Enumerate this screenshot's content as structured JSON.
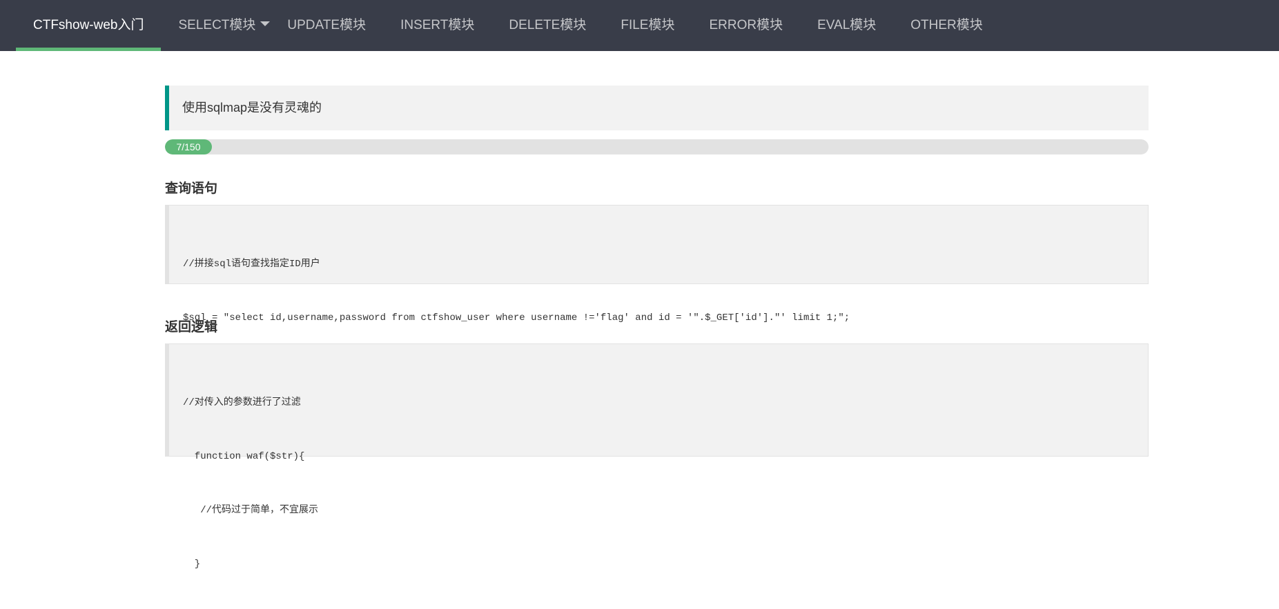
{
  "nav": {
    "items": [
      {
        "label": "CTFshow-web入门",
        "active": true
      },
      {
        "label": "SELECT模块",
        "dropdown": true
      },
      {
        "label": "UPDATE模块"
      },
      {
        "label": "INSERT模块"
      },
      {
        "label": "DELETE模块"
      },
      {
        "label": "FILE模块"
      },
      {
        "label": "ERROR模块"
      },
      {
        "label": "EVAL模块"
      },
      {
        "label": "OTHER模块"
      }
    ]
  },
  "quote": {
    "text": "使用sqlmap是没有灵魂的"
  },
  "progress": {
    "label": "7/150",
    "current": 7,
    "total": 150
  },
  "query": {
    "title": "查询语句",
    "lines": [
      "//拼接sql语句查找指定ID用户",
      "$sql = \"select id,username,password from ctfshow_user where username !='flag' and id = '\".$_GET['id'].\"' limit 1;\";"
    ]
  },
  "logic": {
    "title": "返回逻辑",
    "lines": [
      "//对传入的参数进行了过滤",
      "  function waf($str){",
      "   //代码过于简单，不宜展示",
      "  }"
    ]
  },
  "colors": {
    "nav_bg": "#393D49",
    "accent_green": "#5FB878",
    "quote_border": "#009688"
  }
}
